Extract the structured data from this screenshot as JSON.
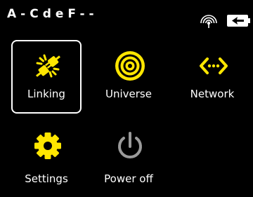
{
  "status_bar": {
    "title": "A-CdeF--",
    "icons": [
      "wifi-signal-icon",
      "battery-charging-icon"
    ]
  },
  "menu": {
    "selected": "Linking",
    "items": [
      {
        "label": "Linking",
        "icon": "linking-plug-icon",
        "icon_color": "#FFE600"
      },
      {
        "label": "Universe",
        "icon": "universe-target-icon",
        "icon_color": "#FFE600"
      },
      {
        "label": "Network",
        "icon": "network-arrows-icon",
        "icon_color": "#FFE600"
      },
      {
        "label": "Settings",
        "icon": "settings-gear-icon",
        "icon_color": "#FFE600"
      },
      {
        "label": "Power off",
        "icon": "power-icon",
        "icon_color": "#9A9A9A"
      }
    ]
  },
  "colors": {
    "background": "#000000",
    "text": "#FFFFFF",
    "accent": "#FFE600",
    "muted_icon": "#9A9A9A",
    "selection_border": "#FFFFFF"
  }
}
